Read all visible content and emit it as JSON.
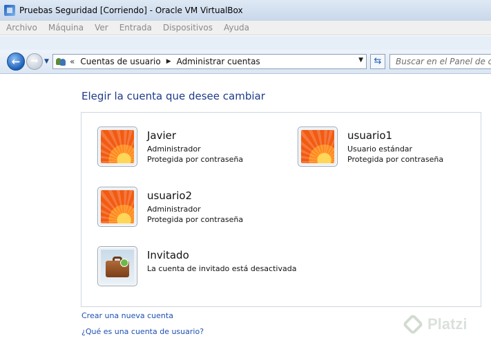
{
  "window": {
    "title": "Pruebas Seguridad  [Corriendo] - Oracle VM VirtualBox"
  },
  "menu": [
    "Archivo",
    "Máquina",
    "Ver",
    "Entrada",
    "Dispositivos",
    "Ayuda"
  ],
  "nav": {
    "back_icon": "back-arrow-icon",
    "forward_icon": "forward-arrow-icon",
    "address_prefix": "«",
    "breadcrumb": [
      "Cuentas de usuario",
      "Administrar cuentas"
    ],
    "search_placeholder": "Buscar en el Panel de control"
  },
  "page": {
    "title": "Elegir la cuenta que desee cambiar",
    "accounts": [
      {
        "name": "Javier",
        "type": "Administrador",
        "status": "Protegida por contraseña",
        "picture": "orange-flower"
      },
      {
        "name": "usuario1",
        "type": "Usuario estándar",
        "status": "Protegida por contraseña",
        "picture": "orange-flower"
      },
      {
        "name": "usuario2",
        "type": "Administrador",
        "status": "Protegida por contraseña",
        "picture": "orange-flower"
      },
      {
        "name": "Invitado",
        "type": "La cuenta de invitado está desactivada",
        "status": "",
        "picture": "guest-briefcase"
      }
    ],
    "links": {
      "create_account": "Crear una nueva cuenta",
      "what_is_account": "¿Qué es una cuenta de usuario?"
    }
  },
  "watermark": {
    "text": "Platzi"
  },
  "colors": {
    "link": "#1c4fb1",
    "title": "#1e3a8a",
    "accent": "#1d5fb8"
  }
}
